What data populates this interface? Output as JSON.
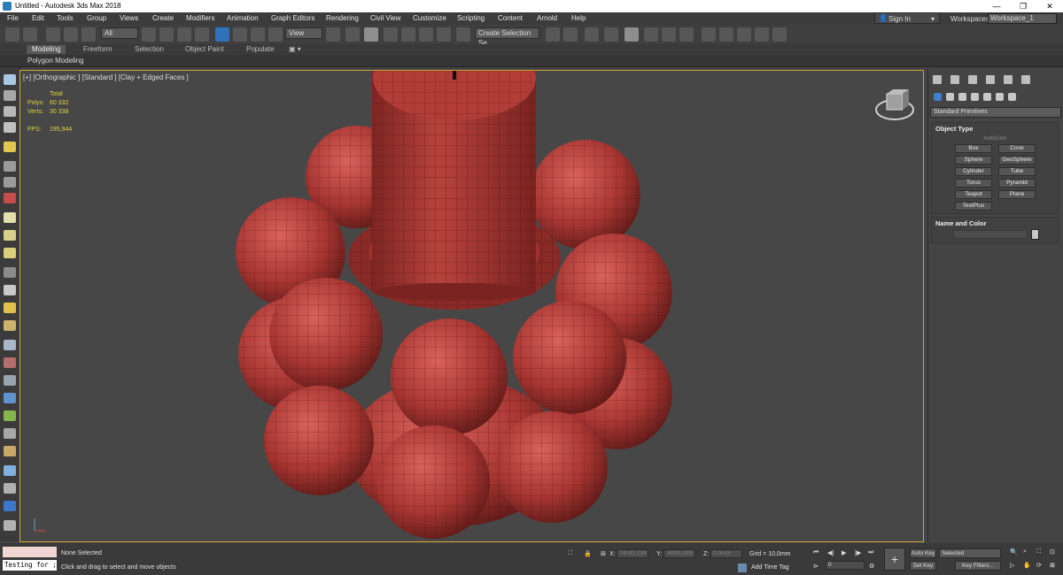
{
  "window": {
    "title": "Untitled - Autodesk 3ds Max 2018",
    "minimize": "—",
    "maximize": "❐",
    "close": "✕"
  },
  "menu": [
    "File",
    "Edit",
    "Tools",
    "Group",
    "Views",
    "Create",
    "Modifiers",
    "Animation",
    "Graph Editors",
    "Rendering",
    "Civil View",
    "Customize",
    "Scripting",
    "Content",
    "Arnold",
    "Help"
  ],
  "signin": {
    "label": "Sign In"
  },
  "workspaces": {
    "label": "Workspaces:",
    "value": "Workspace_1"
  },
  "toolbar": {
    "filter": "All",
    "coord_system": "View",
    "selection_set": "Create Selection Se"
  },
  "ribbon": {
    "tabs": [
      "Modeling",
      "Freeform",
      "Selection",
      "Object Paint",
      "Populate"
    ],
    "subtitle": "Polygon Modeling"
  },
  "viewport": {
    "label": "[+] [Orthographic ] [Standard ] [Clay + Edged Faces ]",
    "stats": {
      "total": "Total",
      "polys_label": "Polys:",
      "polys": "60 332",
      "verts_label": "Verts:",
      "verts": "30 338",
      "fps_label": "FPS:",
      "fps": "195,944"
    },
    "mesh_color": "#b03a35",
    "viewcube_face": "LEFT"
  },
  "command_panel": {
    "dropdown": "Standard Primitives",
    "object_type": {
      "title": "Object Type",
      "autogrid": "AutoGrid",
      "buttons": [
        "Box",
        "Cone",
        "Sphere",
        "GeoSphere",
        "Cylinder",
        "Tube",
        "Torus",
        "Pyramid",
        "Teapot",
        "Plane",
        "TextPlus"
      ]
    },
    "name_color": {
      "title": "Name and Color"
    }
  },
  "status": {
    "maxscript": "Testing for ;",
    "selection": "None Selected",
    "prompt": "Click and drag to select and move objects",
    "x_label": "X:",
    "x": "74041,734",
    "y_label": "Y:",
    "y": "-6099,329",
    "z_label": "Z:",
    "z": "0,0mm",
    "grid": "Grid = 10,0mm",
    "add_time_tag": "Add Time Tag",
    "autokey": "Auto Key",
    "setkey": "Set Key",
    "selected": "Selected",
    "keyfilters": "Key Filters...",
    "frame": "0"
  }
}
